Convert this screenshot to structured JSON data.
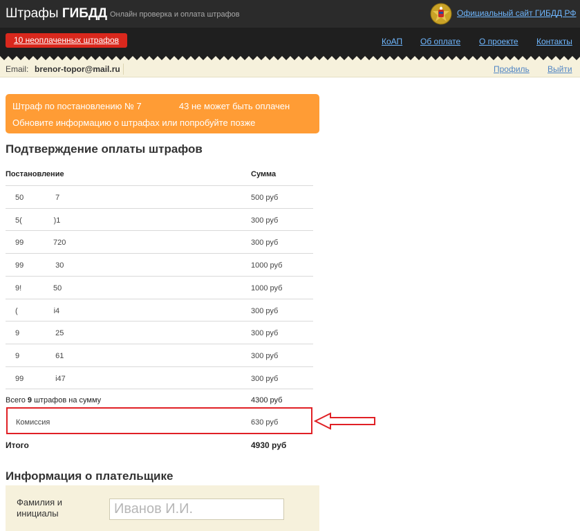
{
  "header": {
    "brand_part1": "Штрафы",
    "brand_part2": "ГИБДД",
    "tagline": "Онлайн проверка и оплата штрафов",
    "official_link": "Официальный сайт ГИБДД РФ",
    "emblem_icon": "gibdd-emblem-icon"
  },
  "nav": {
    "unpaid_button": "10 неоплаченных штрафов",
    "links": [
      "КоАП",
      "Об оплате",
      "О проекте",
      "Контакты"
    ]
  },
  "userbar": {
    "email_label": "Email:",
    "email_value": "brenor-topor@mail.ru",
    "profile_link": "Профиль",
    "logout_link": "Выйти"
  },
  "alert": {
    "line1": "Штраф по постановлению № 7               43 не может быть оплачен",
    "line2": "Обновите информацию о штрафах или попробуйте позже",
    "color": "#ff9c35"
  },
  "confirmation": {
    "title": "Подтверждение оплаты штрафов",
    "col_decree": "Постановление",
    "col_sum": "Сумма",
    "rows": [
      {
        "number": "50               7",
        "sum": "500 руб"
      },
      {
        "number": "5(               )1",
        "sum": "300 руб"
      },
      {
        "number": "99              720",
        "sum": "300 руб"
      },
      {
        "number": "99               30",
        "sum": "1000 руб"
      },
      {
        "number": "9!               50",
        "sum": "1000 руб"
      },
      {
        "number": "(                 i4",
        "sum": "300 руб"
      },
      {
        "number": "9                 25",
        "sum": "300 руб"
      },
      {
        "number": "9                 61",
        "sum": "300 руб"
      },
      {
        "number": "99               i47",
        "sum": "300 руб"
      }
    ],
    "total_prefix": "Всего ",
    "total_count": "9",
    "total_suffix": " штрафов на сумму",
    "total_sum": "4300 руб",
    "commission_label": "Комиссия",
    "commission_sum": "630 руб",
    "grand_label": "Итого",
    "grand_sum": "4930 руб",
    "highlight_color": "#e02025"
  },
  "payer": {
    "title": "Информация о плательщике",
    "name_label": "Фамилия и инициалы",
    "name_placeholder": "Иванов И.И."
  }
}
